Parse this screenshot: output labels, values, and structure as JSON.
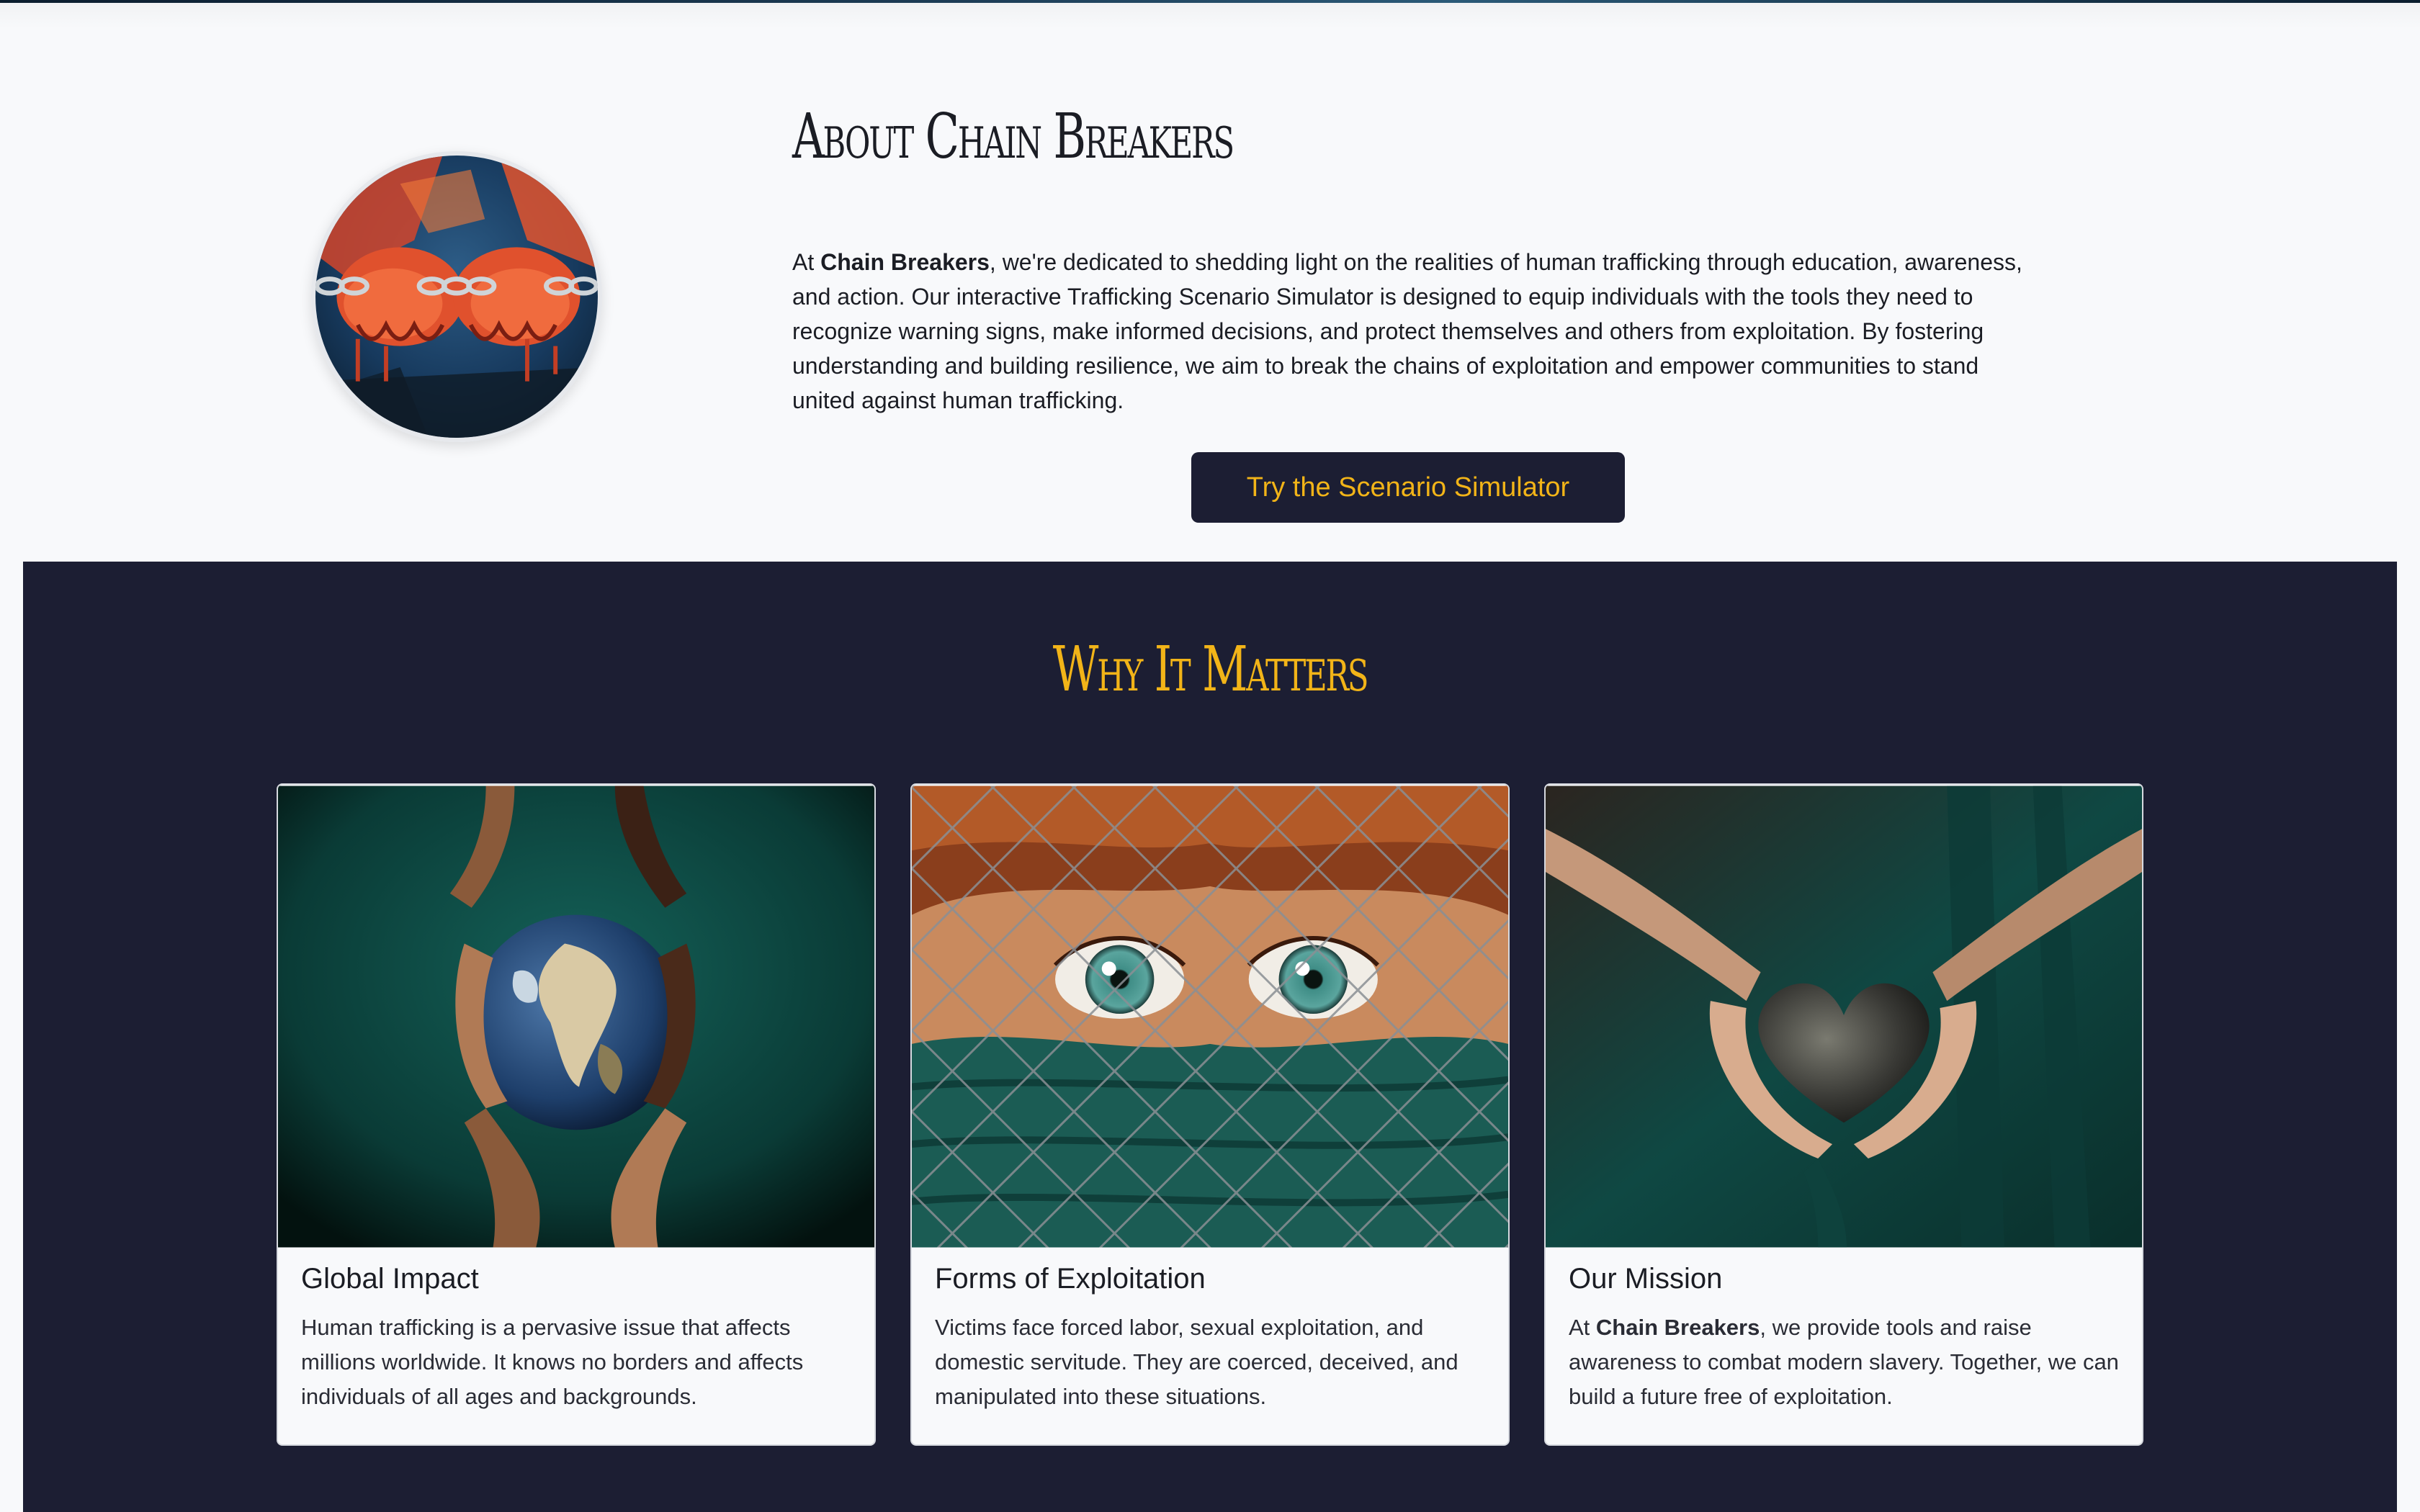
{
  "colors": {
    "accent": "#f2b418",
    "dark_navy": "#1c1e33",
    "page_background": "#f8f9fb",
    "card_teal": "#0e4a45"
  },
  "about": {
    "title": "About Chain Breakers",
    "image_icon": "chained-hands-image",
    "paragraph": {
      "prefix": "At ",
      "brand": "Chain Breakers",
      "body": ", we're dedicated to shedding light on the realities of human trafficking through education, awareness, and action. Our interactive Trafficking Scenario Simulator is designed to equip individuals with the tools they need to recognize warning signs, make informed decisions, and protect themselves and others from exploitation. By fostering understanding and building resilience, we aim to break the chains of exploitation and empower communities to stand united against human trafficking."
    },
    "cta_label": "Try the Scenario Simulator"
  },
  "why": {
    "title": "Why It Matters",
    "cards": [
      {
        "image_icon": "hands-holding-earth-image",
        "title": "Global Impact",
        "text": "Human trafficking is a pervasive issue that affects millions worldwide. It knows no borders and affects individuals of all ages and backgrounds."
      },
      {
        "image_icon": "child-behind-fence-image",
        "title": "Forms of Exploitation",
        "text": "Victims face forced labor, sexual exploitation, and domestic servitude. They are coerced, deceived, and manipulated into these situations."
      },
      {
        "image_icon": "hands-holding-heart-image",
        "title": "Our Mission",
        "text_prefix": "At ",
        "text_brand": "Chain Breakers",
        "text_body": ", we provide tools and raise awareness to combat modern slavery. Together, we can build a future free of exploitation."
      }
    ]
  }
}
